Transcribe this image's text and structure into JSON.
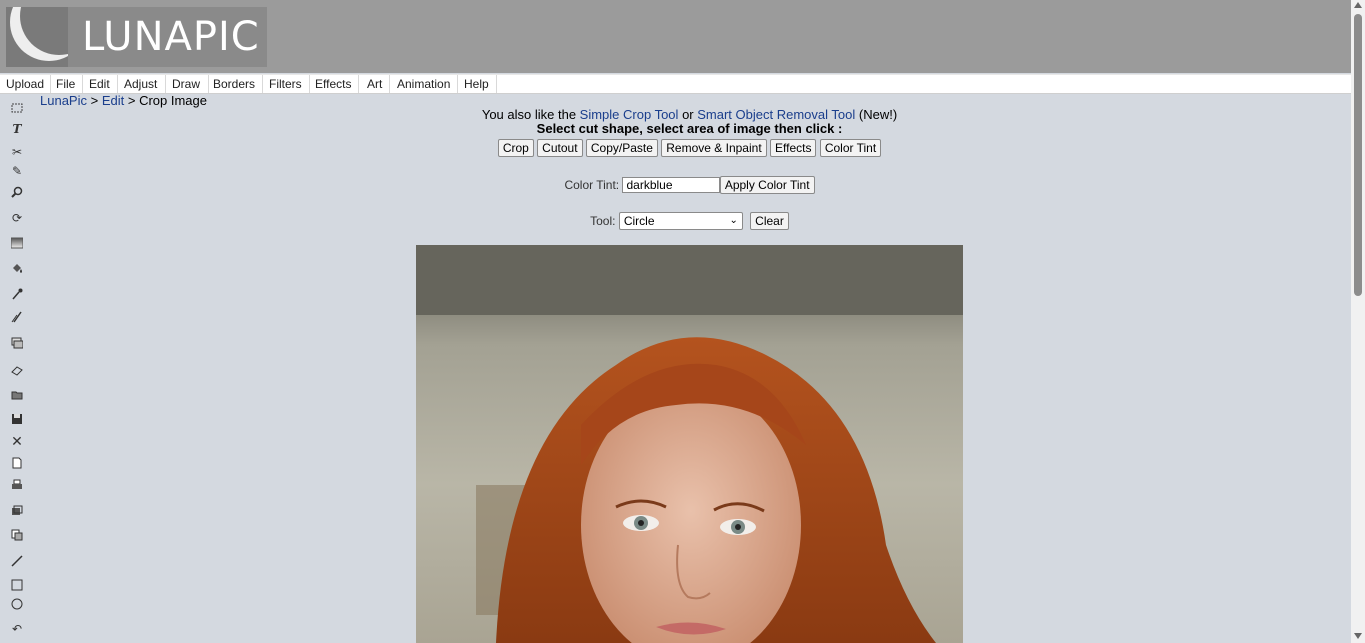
{
  "logo": {
    "text": "LUNAPIC"
  },
  "menu": [
    "Upload",
    "File",
    "Edit",
    "Adjust",
    "Draw",
    "Borders",
    "Filters",
    "Effects",
    "Art",
    "Animation",
    "Help"
  ],
  "breadcrumb": {
    "home": "LunaPic",
    "sep1": ">",
    "section": "Edit",
    "sep2": ">",
    "current": "Crop Image"
  },
  "promo": {
    "prefix": "You also like the",
    "link1": "Simple Crop Tool",
    "middle": "or",
    "link2": "Smart Object Removal Tool",
    "suffix": "(New!)"
  },
  "instruction": "Select cut shape, select area of image then click :",
  "buttons": [
    "Crop",
    "Cutout",
    "Copy/Paste",
    "Remove & Inpaint",
    "Effects",
    "Color Tint"
  ],
  "color_tint": {
    "label": "Color Tint:",
    "value": "darkblue",
    "button": "Apply Color Tint"
  },
  "tool": {
    "label": "Tool:",
    "selected": "Circle",
    "clear": "Clear"
  },
  "toolbar_icons": [
    "select-icon",
    "text-icon",
    "scissors-icon",
    "pencil-icon",
    "zoom-icon",
    "rotate-icon",
    "gradient-icon",
    "fill-icon",
    "eyedropper-icon",
    "brush-icon",
    "crop-icon",
    "eraser-icon",
    "open-icon",
    "save-icon",
    "close-icon",
    "new-icon",
    "print-icon",
    "layers-icon",
    "copy-icon",
    "line-icon",
    "rectangle-icon",
    "circle-icon",
    "undo-icon"
  ]
}
